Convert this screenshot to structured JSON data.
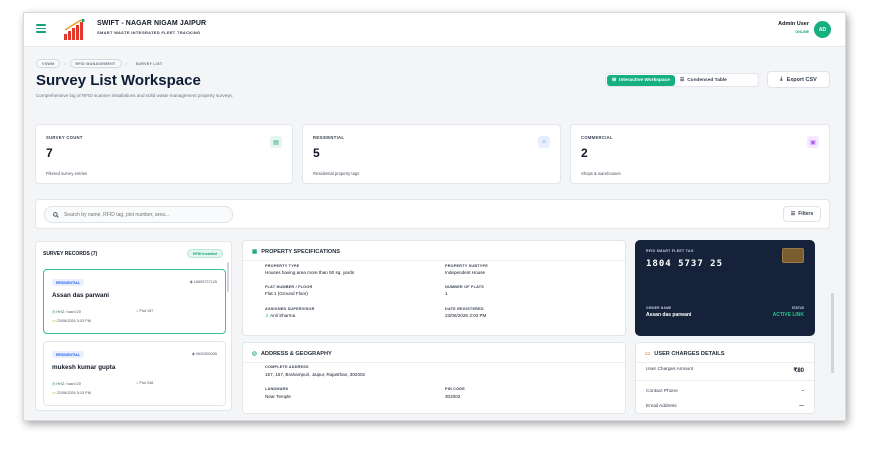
{
  "header": {
    "brand_title": "SWIFT - NAGAR NIGAM JAIPUR",
    "brand_subtitle": "SMART WASTE INTEGRATED FLEET TRACKING",
    "user_name": "Admin User",
    "user_status": "ONLINE",
    "avatar_initials": "AD"
  },
  "breadcrumb": [
    "VSWM",
    "RFID MANAGEMENT",
    "SURVEY LIST"
  ],
  "page": {
    "title": "Survey List Workspace",
    "subtitle": "Comprehensive log of RFID scanner installations and solid waste management property surveys."
  },
  "view_toggle": {
    "interactive_label": "Interactive Workspace",
    "condensed_label": "Condensed Table"
  },
  "export_label": "Export CSV",
  "stats": [
    {
      "label": "SURVEY COUNT",
      "value": "7",
      "note": "Filtered survey entries",
      "icon": "file-icon"
    },
    {
      "label": "RESIDENTIAL",
      "value": "5",
      "note": "Residential property tags",
      "icon": "home-icon"
    },
    {
      "label": "COMMERCIAL",
      "value": "2",
      "note": "Shops & warehouses",
      "icon": "shop-icon"
    }
  ],
  "search": {
    "placeholder": "Search by name, RFID tag, plot number, area..."
  },
  "filters_label": "Filters",
  "records_panel": {
    "title": "SURVEY RECORDS (7)",
    "badge": "RFID Installed",
    "records": [
      {
        "type": "RESIDENTIAL",
        "rfid": "18695737125",
        "name": "Assan das parwani",
        "ward": "HHZ / ward 20",
        "plot": "Plot 157",
        "date": "23/06/2026 3:03 PM"
      },
      {
        "type": "RESIDENTIAL",
        "rfid": "0620900035",
        "name": "mukesh kumar gupta",
        "ward": "HHZ / ward 20",
        "plot": "Plot 248",
        "date": "22/06/2026 5:15 PM"
      }
    ]
  },
  "property": {
    "heading": "PROPERTY SPECIFICATIONS",
    "fields": [
      {
        "label": "PROPERTY TYPE",
        "value": "Houses having area more than 50 sq. yards"
      },
      {
        "label": "PROPERTY SUBTYPE",
        "value": "Independent House"
      },
      {
        "label": "FLAT NUMBER / FLOOR",
        "value": "Flat 1 (Ground Floor)"
      },
      {
        "label": "NUMBER OF FLATS",
        "value": "1"
      },
      {
        "label": "ASSIGNED SUPERVISOR",
        "value": "Anil Sharma"
      },
      {
        "label": "DATE REGISTERED",
        "value": "23/06/2026 3:03 PM"
      }
    ]
  },
  "address": {
    "heading": "ADDRESS & GEOGRAPHY",
    "complete_label": "COMPLETE ADDRESS",
    "complete_value": "157, 157, Brahampuri, Jaipur, Rajasthan, 302002",
    "landmark_label": "LANDMARK",
    "landmark_value": "Near Temple",
    "pin_label": "PIN CODE",
    "pin_value": "302002"
  },
  "rfid_card": {
    "label": "RFID SMART FLEET TAG",
    "number": "1804 5737 25",
    "owner_label": "OWNER NAME",
    "owner_value": "Assan das parwani",
    "status_label": "STATUS",
    "status_value": "ACTIVE LINK"
  },
  "user_charges": {
    "heading": "USER CHARGES DETAILS",
    "amount_label": "User Charges Amount",
    "amount_value": "₹80",
    "phone_label": "Contact Phone",
    "phone_value": "–",
    "email_label": "Email Address",
    "email_value": "—"
  },
  "colors": {
    "accent": "#16b07f",
    "navy": "#0f1d36",
    "card_dark": "#16223a"
  }
}
